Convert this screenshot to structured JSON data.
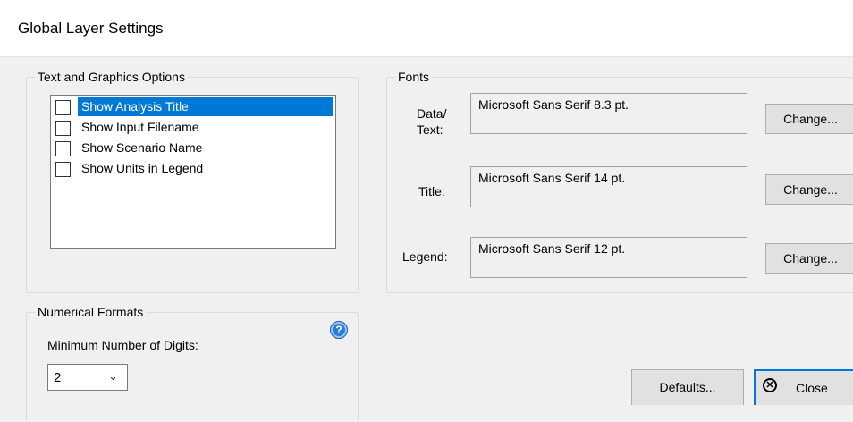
{
  "window": {
    "title": "Global Layer Settings"
  },
  "text_graphics": {
    "legend": "Text and Graphics Options",
    "items": [
      {
        "label": "Show Analysis Title",
        "checked": false,
        "selected": true
      },
      {
        "label": "Show Input Filename",
        "checked": false,
        "selected": false
      },
      {
        "label": "Show Scenario Name",
        "checked": false,
        "selected": false
      },
      {
        "label": "Show Units in Legend",
        "checked": false,
        "selected": false
      }
    ]
  },
  "fonts": {
    "legend": "Fonts",
    "rows": [
      {
        "label_line1": "Data/",
        "label_line2": "Text:",
        "value": "Microsoft Sans Serif 8.3 pt.",
        "button": "Change..."
      },
      {
        "label": "Title:",
        "value": "Microsoft Sans Serif 14 pt.",
        "button": "Change..."
      },
      {
        "label": "Legend:",
        "value": "Microsoft Sans Serif 12 pt.",
        "button": "Change..."
      }
    ]
  },
  "numerical": {
    "legend": "Numerical Formats",
    "min_digits_label": "Minimum Number of Digits:",
    "min_digits_value": "2",
    "help_icon": "?"
  },
  "buttons": {
    "defaults": "Defaults...",
    "close": "Close"
  },
  "colors": {
    "selection": "#0078d7",
    "dialog_bg": "#f0f0f0",
    "help_icon": "#2a7ad6"
  }
}
